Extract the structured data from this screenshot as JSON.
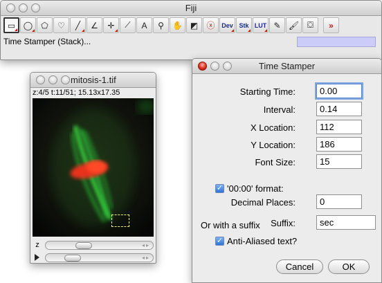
{
  "fiji": {
    "title": "Fiji",
    "tools": [
      {
        "name": "rectangle-tool",
        "glyph": "▭",
        "selected": true
      },
      {
        "name": "oval-tool",
        "glyph": "◯"
      },
      {
        "name": "polygon-tool",
        "glyph": "⬠"
      },
      {
        "name": "freehand-tool",
        "glyph": "♡"
      },
      {
        "name": "line-tool",
        "glyph": "╱"
      },
      {
        "name": "angle-tool",
        "glyph": "∠"
      },
      {
        "name": "point-tool",
        "glyph": "✛"
      },
      {
        "name": "wand-tool",
        "glyph": "⟋"
      },
      {
        "name": "text-tool",
        "glyph": "A"
      },
      {
        "name": "magnifier-tool",
        "glyph": "⚲"
      },
      {
        "name": "hand-tool",
        "glyph": "✋"
      },
      {
        "name": "color-picker-tool",
        "glyph": "◩"
      },
      {
        "name": "delete-overlay-tool",
        "glyph": "ⓧ"
      },
      {
        "name": "dev-menu-tool",
        "glyph": "Dev",
        "text": true
      },
      {
        "name": "stk-menu-tool",
        "glyph": "Stk",
        "text": true
      },
      {
        "name": "lut-menu-tool",
        "glyph": "LUT",
        "text": true
      },
      {
        "name": "pencil-tool",
        "glyph": "✎"
      },
      {
        "name": "brush-tool",
        "glyph": "🖌"
      },
      {
        "name": "flood-fill-tool",
        "glyph": "⛋"
      },
      {
        "name": "more-tools-button",
        "glyph": "»"
      }
    ],
    "status": "Time Stamper (Stack)..."
  },
  "image_window": {
    "title": "mitosis-1.tif",
    "info": "z:4/5 t:11/51; 15.13x17.35",
    "z_label": "z",
    "z_position": 0.35,
    "t_position": 0.2
  },
  "dialog": {
    "title": "Time Stamper",
    "fields": [
      {
        "label": "Starting Time:",
        "value": "0.00",
        "focused": true
      },
      {
        "label": "Interval:",
        "value": "0.14"
      },
      {
        "label": "X Location:",
        "value": "112"
      },
      {
        "label": "Y Location:",
        "value": "186"
      },
      {
        "label": "Font Size:",
        "value": "15"
      }
    ],
    "format_checkbox": "'00:00' format:",
    "decimal_places_label": "Decimal Places:",
    "decimal_places_value": "0",
    "suffix_lead": "Or with a suffix",
    "suffix_label": "Suffix:",
    "suffix_value": "sec",
    "antialias_checkbox": "Anti-Aliased text?",
    "cancel_label": "Cancel",
    "ok_label": "OK"
  },
  "colors": {
    "accent": "#5b86c9",
    "progress": "#ccccf8",
    "spindle_green": "#2fbf3a",
    "chromosome_red": "#e8331e"
  }
}
